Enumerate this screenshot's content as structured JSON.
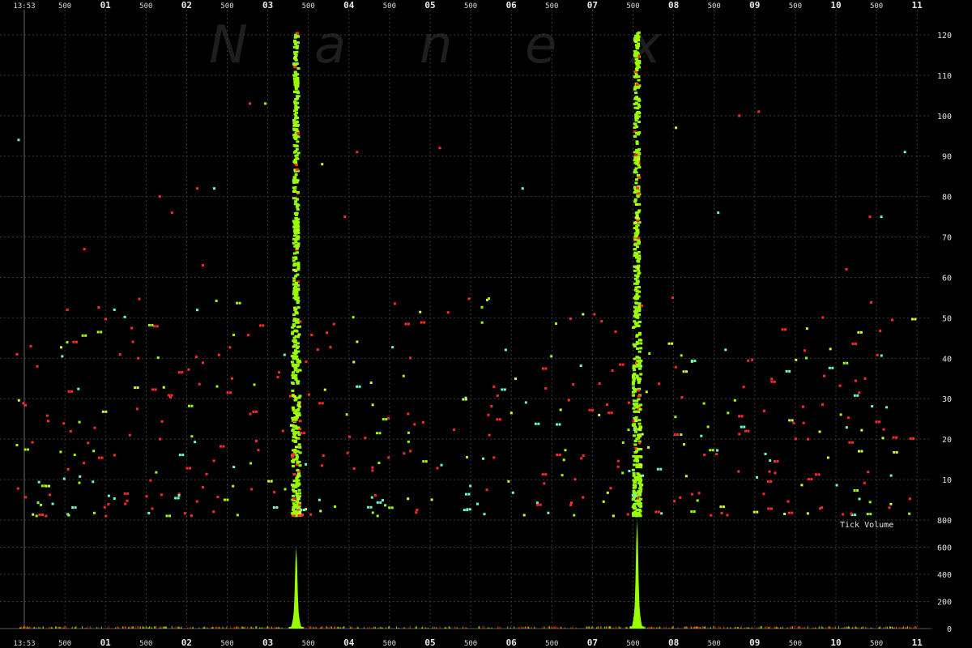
{
  "watermark": [
    "N",
    "a",
    "n",
    "e",
    "x"
  ],
  "annotation": "Tick Volume",
  "chart_data": [
    {
      "type": "scatter",
      "panel": "price",
      "title": "",
      "xlabel": "",
      "ylabel": "",
      "x_start_label": "13:53",
      "x_ticks": [
        "13:53",
        "500",
        "01",
        "500",
        "02",
        "500",
        "03",
        "500",
        "04",
        "500",
        "05",
        "500",
        "06",
        "500",
        "07",
        "500",
        "08",
        "500",
        "09",
        "500",
        "10",
        "500",
        "11"
      ],
      "ylim": [
        0,
        122
      ],
      "y_ticks": [
        10,
        20,
        30,
        40,
        50,
        60,
        70,
        80,
        90,
        100,
        110,
        120
      ],
      "grid": true,
      "colors": {
        "up": "#99ff00",
        "flat": "#66ffcc",
        "down": "#ff2a2a",
        "mid": "#ccff33"
      },
      "bursts": [
        {
          "x_label": "03",
          "x": 3.35,
          "y_range": [
            1,
            121
          ]
        },
        {
          "x_label": "07",
          "x": 7.55,
          "y_range": [
            1,
            121
          ]
        }
      ],
      "sample_points": [
        {
          "x": -0.09,
          "y": 41,
          "c": "down"
        },
        {
          "x": -0.07,
          "y": 94,
          "c": "flat"
        },
        {
          "x": 0.08,
          "y": 43,
          "c": "down"
        },
        {
          "x": 0.16,
          "y": 38,
          "c": "down"
        },
        {
          "x": 0.53,
          "y": 52,
          "c": "down"
        },
        {
          "x": 0.74,
          "y": 67,
          "c": "down"
        },
        {
          "x": 1.11,
          "y": 52,
          "c": "flat"
        },
        {
          "x": 1.67,
          "y": 80,
          "c": "down"
        },
        {
          "x": 1.82,
          "y": 76,
          "c": "down"
        },
        {
          "x": 2.13,
          "y": 82,
          "c": "down"
        },
        {
          "x": 2.34,
          "y": 82,
          "c": "flat"
        },
        {
          "x": 2.2,
          "y": 63,
          "c": "down"
        },
        {
          "x": 2.78,
          "y": 103,
          "c": "down"
        },
        {
          "x": 2.97,
          "y": 103,
          "c": "up"
        },
        {
          "x": 3.67,
          "y": 88,
          "c": "mid"
        },
        {
          "x": 3.95,
          "y": 75,
          "c": "down"
        },
        {
          "x": 4.1,
          "y": 91,
          "c": "down"
        },
        {
          "x": 5.12,
          "y": 92,
          "c": "down"
        },
        {
          "x": 6.14,
          "y": 82,
          "c": "flat"
        },
        {
          "x": 8.03,
          "y": 97,
          "c": "mid"
        },
        {
          "x": 8.55,
          "y": 76,
          "c": "flat"
        },
        {
          "x": 8.81,
          "y": 100,
          "c": "down"
        },
        {
          "x": 9.05,
          "y": 101,
          "c": "down"
        },
        {
          "x": 10.13,
          "y": 62,
          "c": "down"
        },
        {
          "x": 10.42,
          "y": 75,
          "c": "down"
        },
        {
          "x": 10.56,
          "y": 75,
          "c": "flat"
        },
        {
          "x": 10.85,
          "y": 91,
          "c": "flat"
        },
        {
          "x": 4.29,
          "y": 13,
          "c": "down"
        },
        {
          "x": 5.73,
          "y": 21,
          "c": "down"
        },
        {
          "x": 8.8,
          "y": 12,
          "c": "down"
        },
        {
          "x": 9.48,
          "y": 24,
          "c": "down"
        },
        {
          "x": 10.36,
          "y": 35,
          "c": "down"
        },
        {
          "x": 10.68,
          "y": 11,
          "c": "flat"
        },
        {
          "x": 0.35,
          "y": 4,
          "c": "flat"
        },
        {
          "x": 1.3,
          "y": 21,
          "c": "down"
        },
        {
          "x": 2.56,
          "y": 35,
          "c": "down"
        }
      ]
    },
    {
      "type": "area",
      "panel": "volume",
      "series": [
        {
          "name": "Tick Volume",
          "values": []
        }
      ],
      "ylim": [
        0,
        800
      ],
      "y_ticks": [
        0,
        200,
        400,
        600,
        800
      ],
      "peaks": [
        {
          "x": 3.35,
          "value": 600
        },
        {
          "x": 7.55,
          "value": 800
        }
      ]
    }
  ]
}
